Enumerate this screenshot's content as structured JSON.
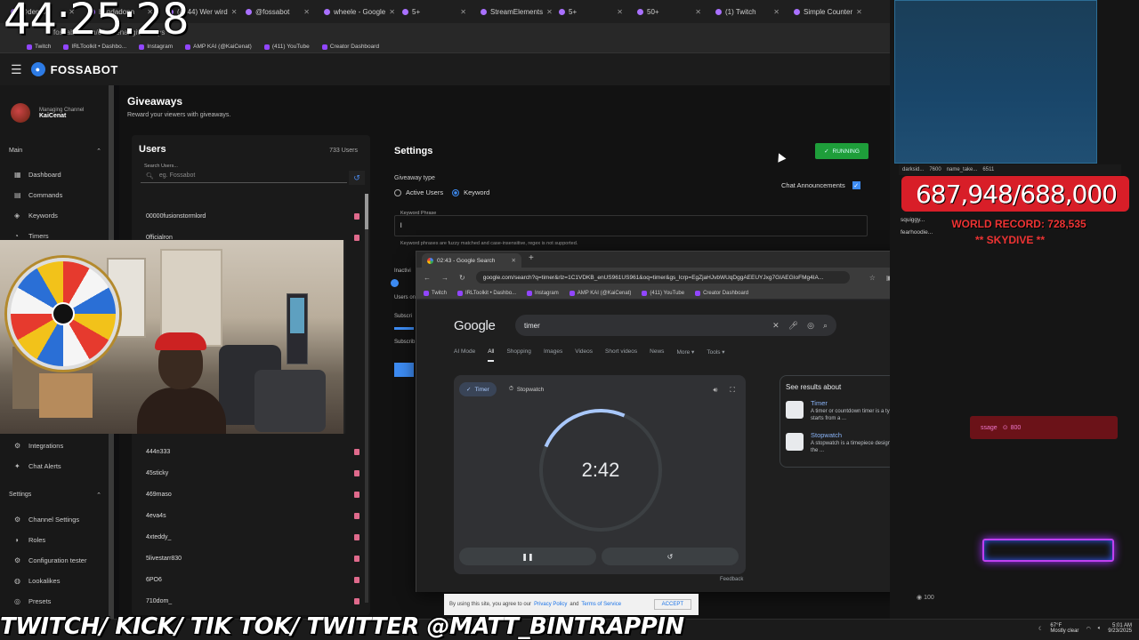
{
  "overlay": {
    "clock": "44:25:28",
    "banner": "TWITCH/ KICK/ TIK TOK/ TWITTER @MATT_BINTRAPPIN",
    "goal": "687,948/688,000",
    "record": "WORLD RECORD: 728,535",
    "skydive": "** SKYDIVE **",
    "alert_count": "800",
    "chat_count": "100"
  },
  "back_browser": {
    "tabs": [
      {
        "label": "@demo"
      },
      {
        "label": "bendadonn"
      },
      {
        "label": "(4844) Wer wird"
      },
      {
        "label": "@fossabot"
      },
      {
        "label": "wheele - Google"
      },
      {
        "label": "5+"
      },
      {
        "label": "StreamElements"
      },
      {
        "label": "5+"
      },
      {
        "label": "50+"
      },
      {
        "label": "(1) Twitch"
      },
      {
        "label": "Simple Counter"
      }
    ],
    "address": "fossabot.com/c/kaicenat/giveaways",
    "bookmarks": [
      "Twitch",
      "IRLToolkit • Dashbo...",
      "Instagram",
      "AMP KAI (@KaiCenat)",
      "(411) YouTube",
      "Creator Dashboard"
    ]
  },
  "fossabot": {
    "brand": "FOSSABOT",
    "managing_label": "Managing Channel",
    "managing_channel": "KaiCenat",
    "main_section": "Main",
    "settings_section": "Settings",
    "nav_main": [
      "Dashboard",
      "Commands",
      "Keywords",
      "Timers"
    ],
    "nav_mid": [
      "Integrations",
      "Chat Alerts"
    ],
    "nav_settings": [
      "Channel Settings",
      "Roles",
      "Configuration tester",
      "Lookalikes",
      "Presets"
    ],
    "page_title": "Giveaways",
    "page_subtitle": "Reward your viewers with giveaways.",
    "users": {
      "title": "Users",
      "count": "733 Users",
      "search_label": "Search Users...",
      "search_placeholder": "eg. Fossabot",
      "rows": [
        "00000fusionstormlord",
        "0fficialron",
        "444n333",
        "45sticky",
        "469maso",
        "4eva4s",
        "4xteddy_",
        "5livestarr830",
        "6PO6",
        "710dom_"
      ]
    },
    "settings": {
      "title": "Settings",
      "running": "RUNNING",
      "giveaway_type_label": "Giveaway type",
      "option_active": "Active Users",
      "option_keyword": "Keyword",
      "chat_announcements": "Chat Announcements",
      "keyword_label": "Keyword Phrase",
      "keyword_value": "l",
      "keyword_hint": "Keyword phrases are fuzzy matched and case-insensitive, regex is not supported.",
      "partial_1": "Inactivi",
      "partial_2": "Users on",
      "partial_3": "Subscri",
      "partial_4": "Subscrib"
    }
  },
  "google_window": {
    "tab_title": "02:43 - Google Search",
    "url": "google.com/search?q=timer&rlz=1C1VDKB_enUS961US961&oq=timer&gs_lcrp=EgZjaHJvbWUqDggAEEUYJxg7GIAEGIoFMg4IA...",
    "bookmarks": [
      "Twitch",
      "IRLToolkit • Dashbo...",
      "Instagram",
      "AMP KAI (@KaiCenat)",
      "(411) YouTube",
      "Creator Dashboard"
    ],
    "logo": "Google",
    "query": "timer",
    "tabs": [
      "AI Mode",
      "All",
      "Shopping",
      "Images",
      "Videos",
      "Short videos",
      "News",
      "More ▾",
      "Tools ▾"
    ],
    "timer_tab": "Timer",
    "stopwatch_tab": "Stopwatch",
    "timer_value": "2:42",
    "timer_progress": 0.19,
    "feedback": "Feedback",
    "see_results": "See results about",
    "results": [
      {
        "name": "Timer",
        "desc": "A timer or countdown timer is a type of clock that starts from a ..."
      },
      {
        "name": "Stopwatch",
        "desc": "A stopwatch is a timepiece designed to measure the ..."
      }
    ],
    "cookie_text_1": "By using this site, you agree to our",
    "cookie_link_1": "Privacy Policy",
    "cookie_and": "and",
    "cookie_link_2": "Terms of Service",
    "accept": "ACCEPT"
  },
  "right_panel": {
    "chat_users": [
      "darksid...",
      "7600",
      "name_take...",
      "6511"
    ],
    "chat_names": [
      "squiggy...",
      "fearhoodie..."
    ],
    "alert_label": "ssage"
  },
  "taskbar": {
    "weather_temp": "67°F",
    "weather_desc": "Mostly clear",
    "time": "5:01 AM",
    "date": "9/23/2025"
  }
}
